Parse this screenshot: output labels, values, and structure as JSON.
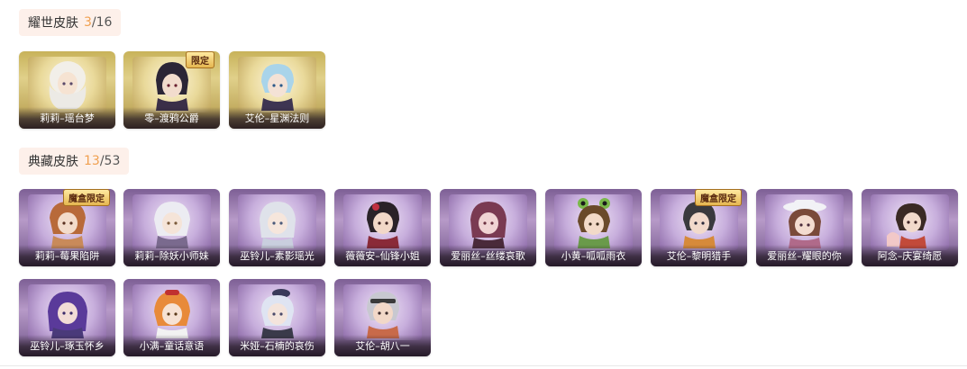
{
  "sections": [
    {
      "title": "耀世皮肤",
      "owned": "3",
      "separator": "/",
      "total": "16",
      "items": [
        {
          "name": "莉莉–瑶台梦",
          "badge": ""
        },
        {
          "name": "零–渡鸦公爵",
          "badge": "限定"
        },
        {
          "name": "艾伦–星渊法则",
          "badge": ""
        }
      ]
    },
    {
      "title": "典藏皮肤",
      "owned": "13",
      "separator": "/",
      "total": "53",
      "items": [
        {
          "name": "莉莉–莓果陷阱",
          "badge": "魔盒限定"
        },
        {
          "name": "莉莉–除妖小师妹",
          "badge": ""
        },
        {
          "name": "巫铃儿–素影瑶光",
          "badge": ""
        },
        {
          "name": "薇薇安–仙锋小姐",
          "badge": ""
        },
        {
          "name": "爱丽丝–丝缕哀歌",
          "badge": ""
        },
        {
          "name": "小黄–呱呱雨衣",
          "badge": ""
        },
        {
          "name": "艾伦–黎明猎手",
          "badge": "魔盒限定"
        },
        {
          "name": "爱丽丝–耀眼的你",
          "badge": ""
        },
        {
          "name": "阿念–庆宴绮愿",
          "badge": ""
        },
        {
          "name": "巫铃儿–琢玉怀乡",
          "badge": ""
        },
        {
          "name": "小满–童话意语",
          "badge": ""
        },
        {
          "name": "米娅–石楠的哀伤",
          "badge": ""
        },
        {
          "name": "艾伦–胡八一",
          "badge": ""
        }
      ]
    }
  ],
  "colors": {
    "header_bg": "#fdf0ea",
    "owned_count": "#f0a050",
    "gold_frame": "#c8b25a",
    "purple_frame": "#7d5f95"
  }
}
